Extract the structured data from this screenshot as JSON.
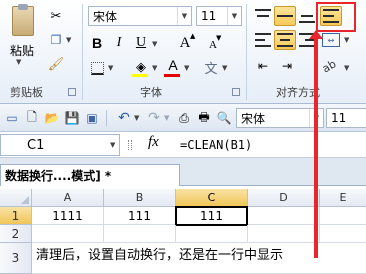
{
  "ribbon": {
    "clipboard": {
      "paste_label": "粘贴",
      "group_label": "剪贴板"
    },
    "font": {
      "font_name": "宋体",
      "font_size": "11",
      "bold": "B",
      "italic": "I",
      "underline": "U",
      "grow": "A",
      "shrink": "A",
      "font_color_glyph": "A",
      "group_label": "字体"
    },
    "alignment": {
      "group_label": "对齐方式"
    }
  },
  "qat": {
    "font_name": "宋体",
    "font_size": "11"
  },
  "formula_bar": {
    "name_box": "C1",
    "fx": "fx",
    "formula": "=CLEAN(B1)"
  },
  "workbook_tab": {
    "title": "数据换行....模式] *"
  },
  "grid": {
    "columns": [
      "A",
      "B",
      "C",
      "D",
      "E"
    ],
    "rows": [
      "1",
      "2",
      "3"
    ],
    "cells": {
      "A1": "1111",
      "B1": "111",
      "C1": "111"
    },
    "row3_text": "清理后，设置自动换行，还是在一行中显示"
  },
  "colors": {
    "annotation": "#e8262b",
    "selected_header": "#f1c65a"
  }
}
